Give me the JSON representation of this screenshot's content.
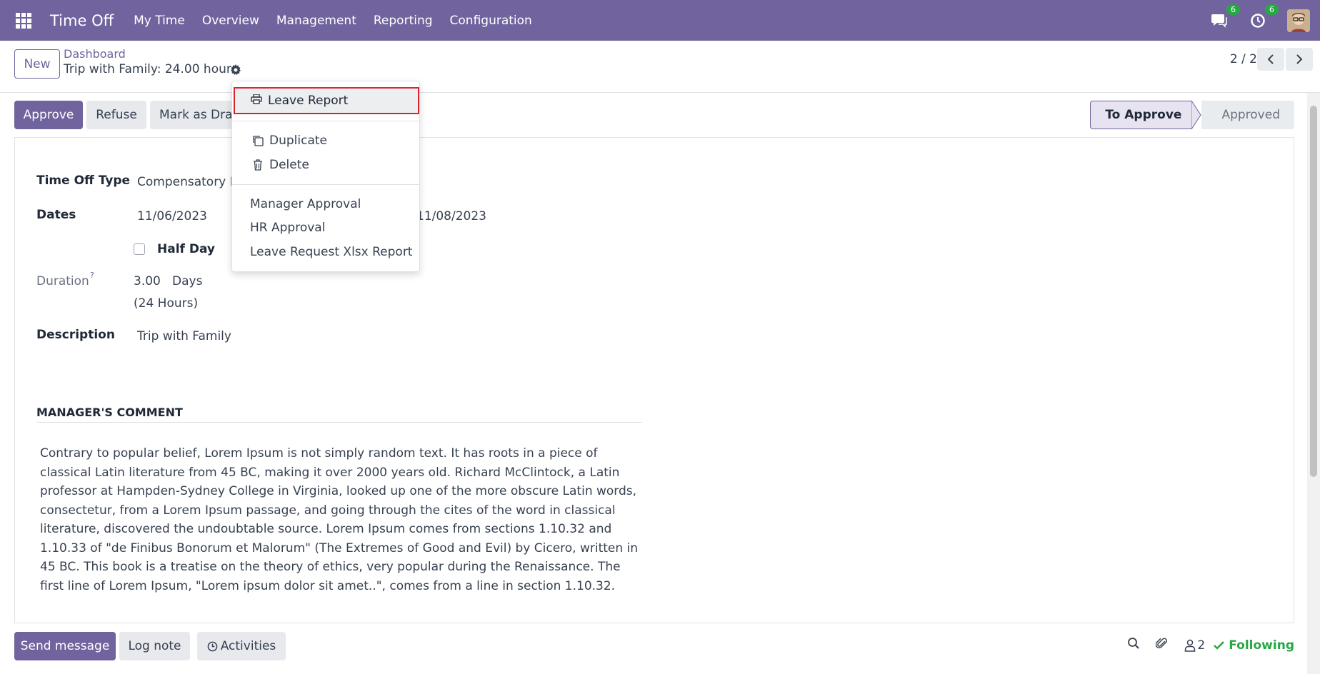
{
  "navbar": {
    "app_name": "Time Off",
    "menu": [
      "My Time",
      "Overview",
      "Management",
      "Reporting",
      "Configuration"
    ],
    "messages_count": "6",
    "activities_count": "6"
  },
  "control": {
    "new_label": "New",
    "breadcrumb": "Dashboard",
    "record_title": "Trip with Family: 24.00 hours",
    "pager": "2 / 2"
  },
  "actions": {
    "approve": "Approve",
    "refuse": "Refuse",
    "mark_draft": "Mark as Draft"
  },
  "status": {
    "active": "To Approve",
    "next": "Approved"
  },
  "form": {
    "time_off_type_label": "Time Off Type",
    "time_off_type_value": "Compensatory Days",
    "dates_label": "Dates",
    "date_from": "11/06/2023",
    "date_to": "11/08/2023",
    "half_day_label": "Half Day",
    "duration_label": "Duration",
    "duration_tooltip": "?",
    "duration_value": "3.00",
    "duration_unit": "Days",
    "duration_hours": "(24 Hours)",
    "description_label": "Description",
    "description_value": "Trip with Family",
    "manager_comment_title": "MANAGER'S COMMENT",
    "manager_comment": "Contrary to popular belief, Lorem Ipsum is not simply random text. It has roots in a piece of classical Latin literature from 45 BC, making it over 2000 years old. Richard McClintock, a Latin professor at Hampden-Sydney College in Virginia, looked up one of the more obscure Latin words, consectetur, from a Lorem Ipsum passage, and going through the cites of the word in classical literature, discovered the undoubtable source. Lorem Ipsum comes from sections 1.10.32 and 1.10.33 of \"de Finibus Bonorum et Malorum\" (The Extremes of Good and Evil) by Cicero, written in 45 BC. This book is a treatise on the theory of ethics, very popular during the Renaissance. The first line of Lorem Ipsum, \"Lorem ipsum dolor sit amet..\", comes from a line in section 1.10.32."
  },
  "dropdown": {
    "leave_report": "Leave Report",
    "duplicate": "Duplicate",
    "delete": "Delete",
    "manager_approval": "Manager Approval",
    "hr_approval": "HR Approval",
    "xlsx_report": "Leave Request Xlsx Report"
  },
  "chatter": {
    "send_message": "Send message",
    "log_note": "Log note",
    "activities": "Activities",
    "followers_count": "2",
    "following": "Following"
  },
  "colors": {
    "brand": "#71639e",
    "highlight_border": "#d9232e",
    "following": "#28a745"
  }
}
